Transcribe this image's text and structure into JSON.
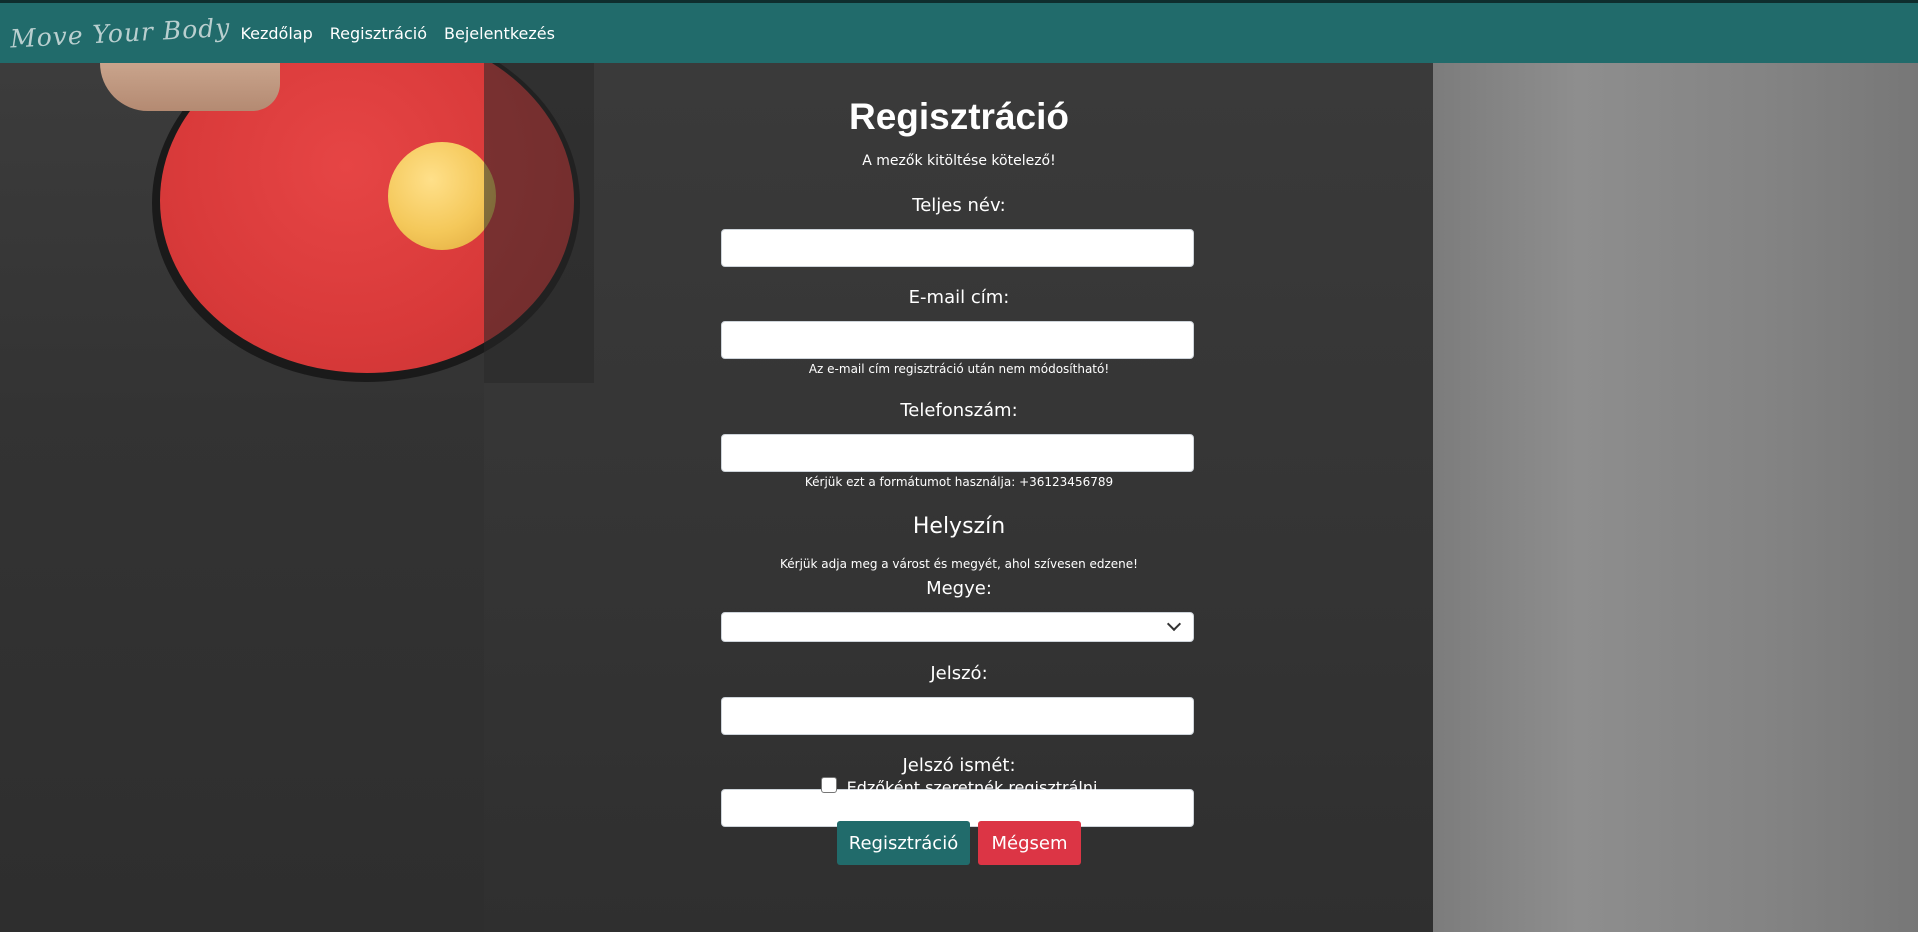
{
  "navbar": {
    "brand": "Move Your Body",
    "links": [
      "Kezdőlap",
      "Regisztráció",
      "Bejelentkezés"
    ]
  },
  "form": {
    "title": "Regisztráció",
    "subtitle": "A mezők kitöltése kötelező!",
    "full_name_label": "Teljes név:",
    "email_label": "E-mail cím:",
    "email_hint": "Az e-mail cím regisztráció után nem módosítható!",
    "phone_label": "Telefonszám:",
    "phone_hint": "Kérjük ezt a formátumot használja: +36123456789",
    "location_title": "Helyszín",
    "location_hint": "Kérjük adja meg a várost és megyét, ahol szívesen edzene!",
    "county_label": "Megye:",
    "password_label": "Jelszó:",
    "password_again_label": "Jelszó ismét:",
    "trainer_checkbox_label": "Edzőként szeretnék regisztrálni",
    "submit_label": "Regisztráció",
    "cancel_label": "Mégsem"
  },
  "colors": {
    "navbar": "#216b6b",
    "primary_button": "#216b6b",
    "danger_button": "#dc3545"
  }
}
